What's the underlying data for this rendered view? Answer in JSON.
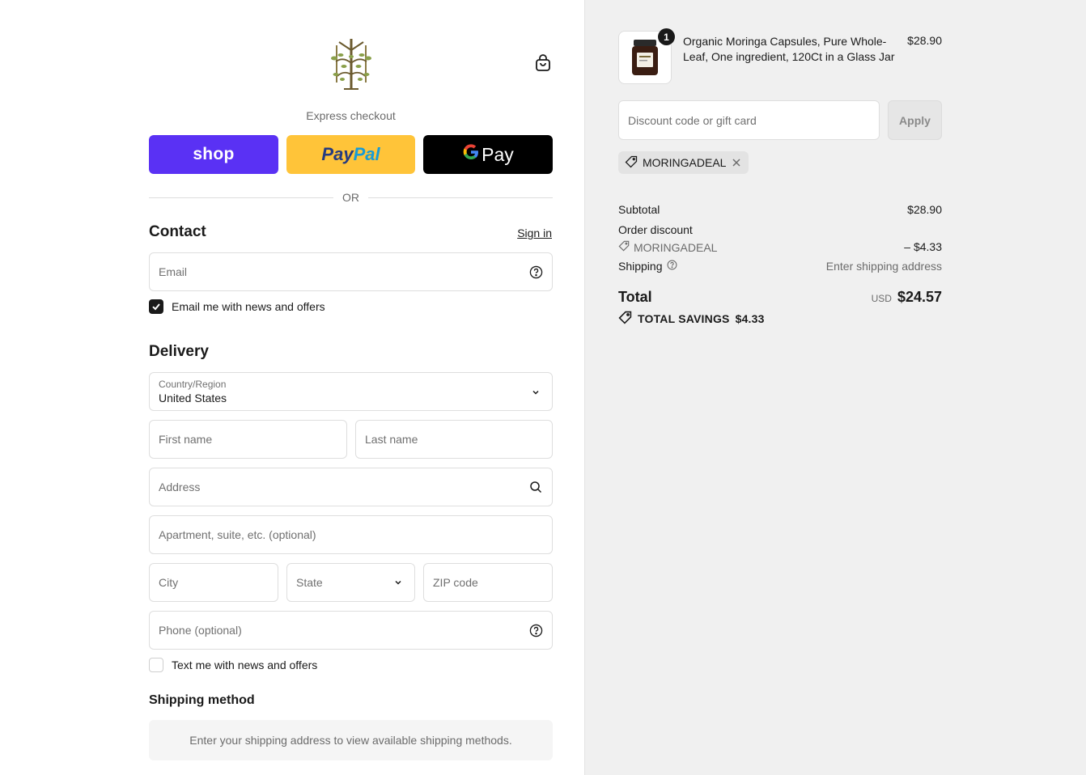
{
  "header": {
    "logo_icon": "moringa-tree-logo-icon",
    "cart_icon": "shopping-bag-icon"
  },
  "express": {
    "label": "Express checkout",
    "shop_label": "shop",
    "paypal_label_1": "Pay",
    "paypal_label_2": "Pal",
    "gpay_g": "G",
    "gpay_label": "Pay",
    "or_label": "OR"
  },
  "contact": {
    "title": "Contact",
    "signin_label": "Sign in",
    "email_placeholder": "Email",
    "news_checkbox_label": "Email me with news and offers",
    "news_checked": true
  },
  "delivery": {
    "title": "Delivery",
    "country_label": "Country/Region",
    "country_value": "United States",
    "first_name_placeholder": "First name",
    "last_name_placeholder": "Last name",
    "address_placeholder": "Address",
    "apartment_placeholder": "Apartment, suite, etc. (optional)",
    "city_placeholder": "City",
    "state_placeholder": "State",
    "zip_placeholder": "ZIP code",
    "phone_placeholder": "Phone (optional)",
    "sms_checkbox_label": "Text me with news and offers",
    "sms_checked": false
  },
  "shipping_method": {
    "title": "Shipping method",
    "message": "Enter your shipping address to view available shipping methods."
  },
  "order": {
    "item": {
      "quantity": "1",
      "name": "Organic Moringa Capsules, Pure Whole-Leaf, One ingredient, 120Ct in a Glass Jar",
      "price": "$28.90"
    },
    "discount_placeholder": "Discount code or gift card",
    "apply_label": "Apply",
    "applied_code": "MORINGADEAL",
    "subtotal_label": "Subtotal",
    "subtotal_value": "$28.90",
    "order_discount_label": "Order discount",
    "order_discount_code": "MORINGADEAL",
    "order_discount_value": "– $4.33",
    "shipping_label": "Shipping",
    "shipping_value": "Enter shipping address",
    "total_label": "Total",
    "total_currency": "USD",
    "total_value": "$24.57",
    "savings_label": "TOTAL SAVINGS",
    "savings_value": "$4.33"
  },
  "colors": {
    "shop_pay": "#5a31f4",
    "paypal": "#ffc439",
    "gpay": "#000000",
    "summary_bg": "#f0f0f0"
  }
}
